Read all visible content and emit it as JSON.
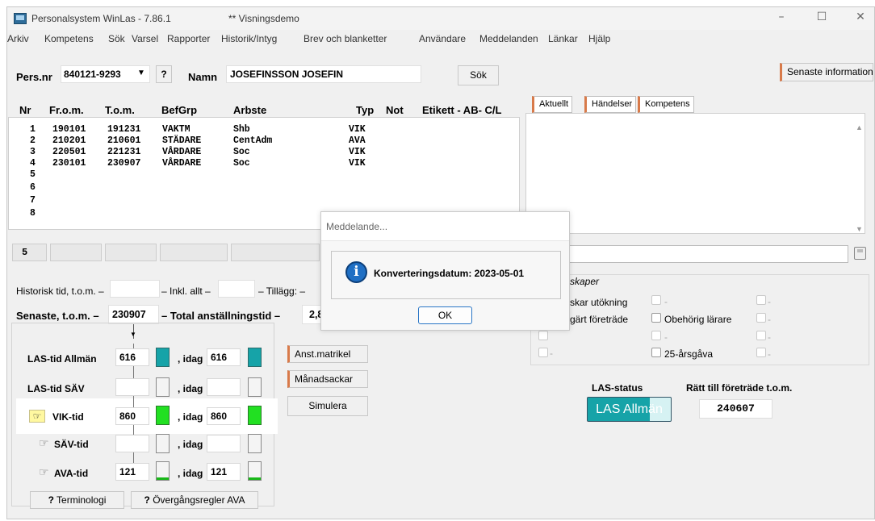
{
  "window": {
    "title": "Personalsystem WinLas - 7.86.1",
    "demo_label": "** Visningsdemo",
    "controls": {
      "minimize": "–",
      "maximize": "☐",
      "close": "✕"
    }
  },
  "menu": [
    "Arkiv",
    "Kompetens",
    "Sök",
    "Varsel",
    "Rapporter",
    "Historik/Intyg",
    "Brev och blanketter",
    "Användare",
    "Meddelanden",
    "Länkar",
    "Hjälp"
  ],
  "person": {
    "pnr_label": "Pers.nr",
    "pnr_value": "840121-9293",
    "help_label": "?",
    "namn_label": "Namn",
    "namn_value": "JOSEFINSSON JOSEFIN",
    "search_button": "Sök",
    "latest_info_button": "Senaste information"
  },
  "table": {
    "headers": [
      "Nr",
      "Fr.o.m.",
      "T.o.m.",
      "BefGrp",
      "Arbste",
      "Typ",
      "Not",
      "Etikett - AB- C/L"
    ],
    "rows": [
      {
        "nr": "1",
        "from": "190101",
        "tom": "191231",
        "befgrp": "VAKTM",
        "arbste": "Shb",
        "typ": "VIK"
      },
      {
        "nr": "2",
        "from": "210201",
        "tom": "210601",
        "befgrp": "STÄDARE",
        "arbste": "CentAdm",
        "typ": "AVA"
      },
      {
        "nr": "3",
        "from": "220501",
        "tom": "221231",
        "befgrp": "VÅRDARE",
        "arbste": "Soc",
        "typ": "VIK"
      },
      {
        "nr": "4",
        "from": "230101",
        "tom": "230907",
        "befgrp": "VÅRDARE",
        "arbste": "Soc",
        "typ": "VIK"
      },
      {
        "nr": "5"
      },
      {
        "nr": "6"
      },
      {
        "nr": "7"
      },
      {
        "nr": "8"
      }
    ],
    "edit_nr": "5"
  },
  "right_tabs": [
    "Aktuellt",
    "Händelser",
    "Kompetens"
  ],
  "summary": {
    "historisk_label": "Historisk tid, t.o.m. –",
    "inkl_label": "– Inkl. allt –",
    "tillagg_label": "– Tillägg: –",
    "senaste_label": "Senaste, t.o.m. –",
    "senaste_value": "230907",
    "total_label": "– Total anställningstid –",
    "total_value": "2,8"
  },
  "las": {
    "rows": [
      {
        "label": "LAS-tid Allmän",
        "value": "616",
        "idag_label": ", idag",
        "idag_value": "616"
      },
      {
        "label": "LAS-tid SÄV",
        "value": "",
        "idag_label": ", idag",
        "idag_value": ""
      },
      {
        "label": "VIK-tid",
        "value": "860",
        "idag_label": ", idag",
        "idag_value": "860"
      },
      {
        "label": "SÄV-tid",
        "value": "",
        "idag_label": ", idag",
        "idag_value": ""
      },
      {
        "label": "AVA-tid",
        "value": "121",
        "idag_label": ", idag",
        "idag_value": "121"
      }
    ],
    "terminologi_button": "Terminologi",
    "overgang_button": "Övergångsregler AVA",
    "help_glyph": "?"
  },
  "side_buttons": [
    "Anst.matrikel",
    "Månadsackar",
    "Simulera"
  ],
  "properties": {
    "header": "skaper",
    "col1": [
      "skar utökning",
      "gärt företräde",
      "",
      ""
    ],
    "col2": [
      "-",
      "Obehörig lärare",
      "-",
      "25-årsgåva"
    ],
    "col3": [
      "-",
      "-",
      "-",
      "-"
    ]
  },
  "status": {
    "las_status_label": "LAS-status",
    "las_status_value": "LAS Allmän",
    "foretrade_label": "Rätt till företräde t.o.m.",
    "foretrade_value": "240607"
  },
  "dialog": {
    "title": "Meddelande...",
    "message": "Konverteringsdatum: 2023-05-01",
    "ok_button": "OK"
  }
}
